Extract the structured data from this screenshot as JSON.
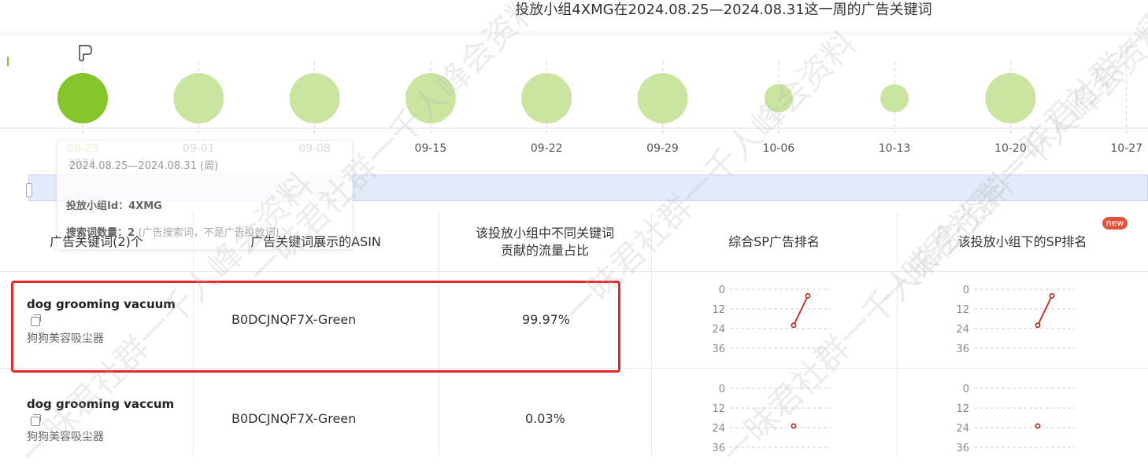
{
  "title": "投放小组4XMG在2024.08.25—2024.08.31这一周的广告关键词",
  "timeline": {
    "ticks": [
      "08-25",
      "09-01",
      "09-08",
      "09-15",
      "09-22",
      "09-29",
      "10-06",
      "10-13",
      "10-20",
      "10-27"
    ],
    "year": "2024",
    "bubble_levels": [
      "large",
      "large",
      "large",
      "large",
      "large",
      "large",
      "small",
      "small",
      "large"
    ],
    "selected_index": 0,
    "selected_color": "#85c52a",
    "bubble_color": "#c9e59f"
  },
  "tooltip": {
    "date": "2024.08.25—2024.08.31 (周)",
    "group_label": "投放小组Id：",
    "group_value": "4XMG",
    "count_label": "搜索词数量：",
    "count_value": "2",
    "count_note": "(广告搜索词，不是广告投放词)"
  },
  "table": {
    "headers": {
      "keyword": "广告关键词(2)个",
      "asin": "广告关键词展示的ASIN",
      "share": "该投放小组中不同关键词贡献的流量占比",
      "share_line1": "该投放小组中不同关键词",
      "share_line2": "贡献的流量占比",
      "sp_rank": "综合SP广告排名",
      "group_rank": "该投放小组下的SP排名",
      "new_badge": "new"
    },
    "rows": [
      {
        "keyword": "dog grooming vacuum",
        "keyword_zh": "狗狗美容吸尘器",
        "asin": "B0DCJNQF7X-Green",
        "share": "99.97%",
        "highlighted": true
      },
      {
        "keyword": "dog grooming vaccum",
        "keyword_zh": "狗狗美容吸尘器",
        "asin": "B0DCJNQF7X-Green",
        "share": "0.03%",
        "highlighted": false
      }
    ]
  },
  "mini_axis_labels": [
    "0",
    "12",
    "24",
    "36"
  ],
  "chart_data": [
    {
      "type": "line",
      "series": [
        {
          "values": [
            22,
            4
          ]
        }
      ],
      "ylim": [
        0,
        36
      ],
      "y_reversed": true
    },
    {
      "type": "line",
      "series": [
        {
          "values": [
            22,
            4
          ]
        }
      ],
      "ylim": [
        0,
        36
      ],
      "y_reversed": true
    },
    {
      "type": "scatter",
      "series": [
        {
          "values": [
            23
          ]
        }
      ],
      "ylim": [
        0,
        36
      ],
      "y_reversed": true
    },
    {
      "type": "scatter",
      "series": [
        {
          "values": [
            23
          ]
        }
      ],
      "ylim": [
        0,
        36
      ],
      "y_reversed": true
    }
  ],
  "watermark": "一昧君社群一千人峰会资料"
}
